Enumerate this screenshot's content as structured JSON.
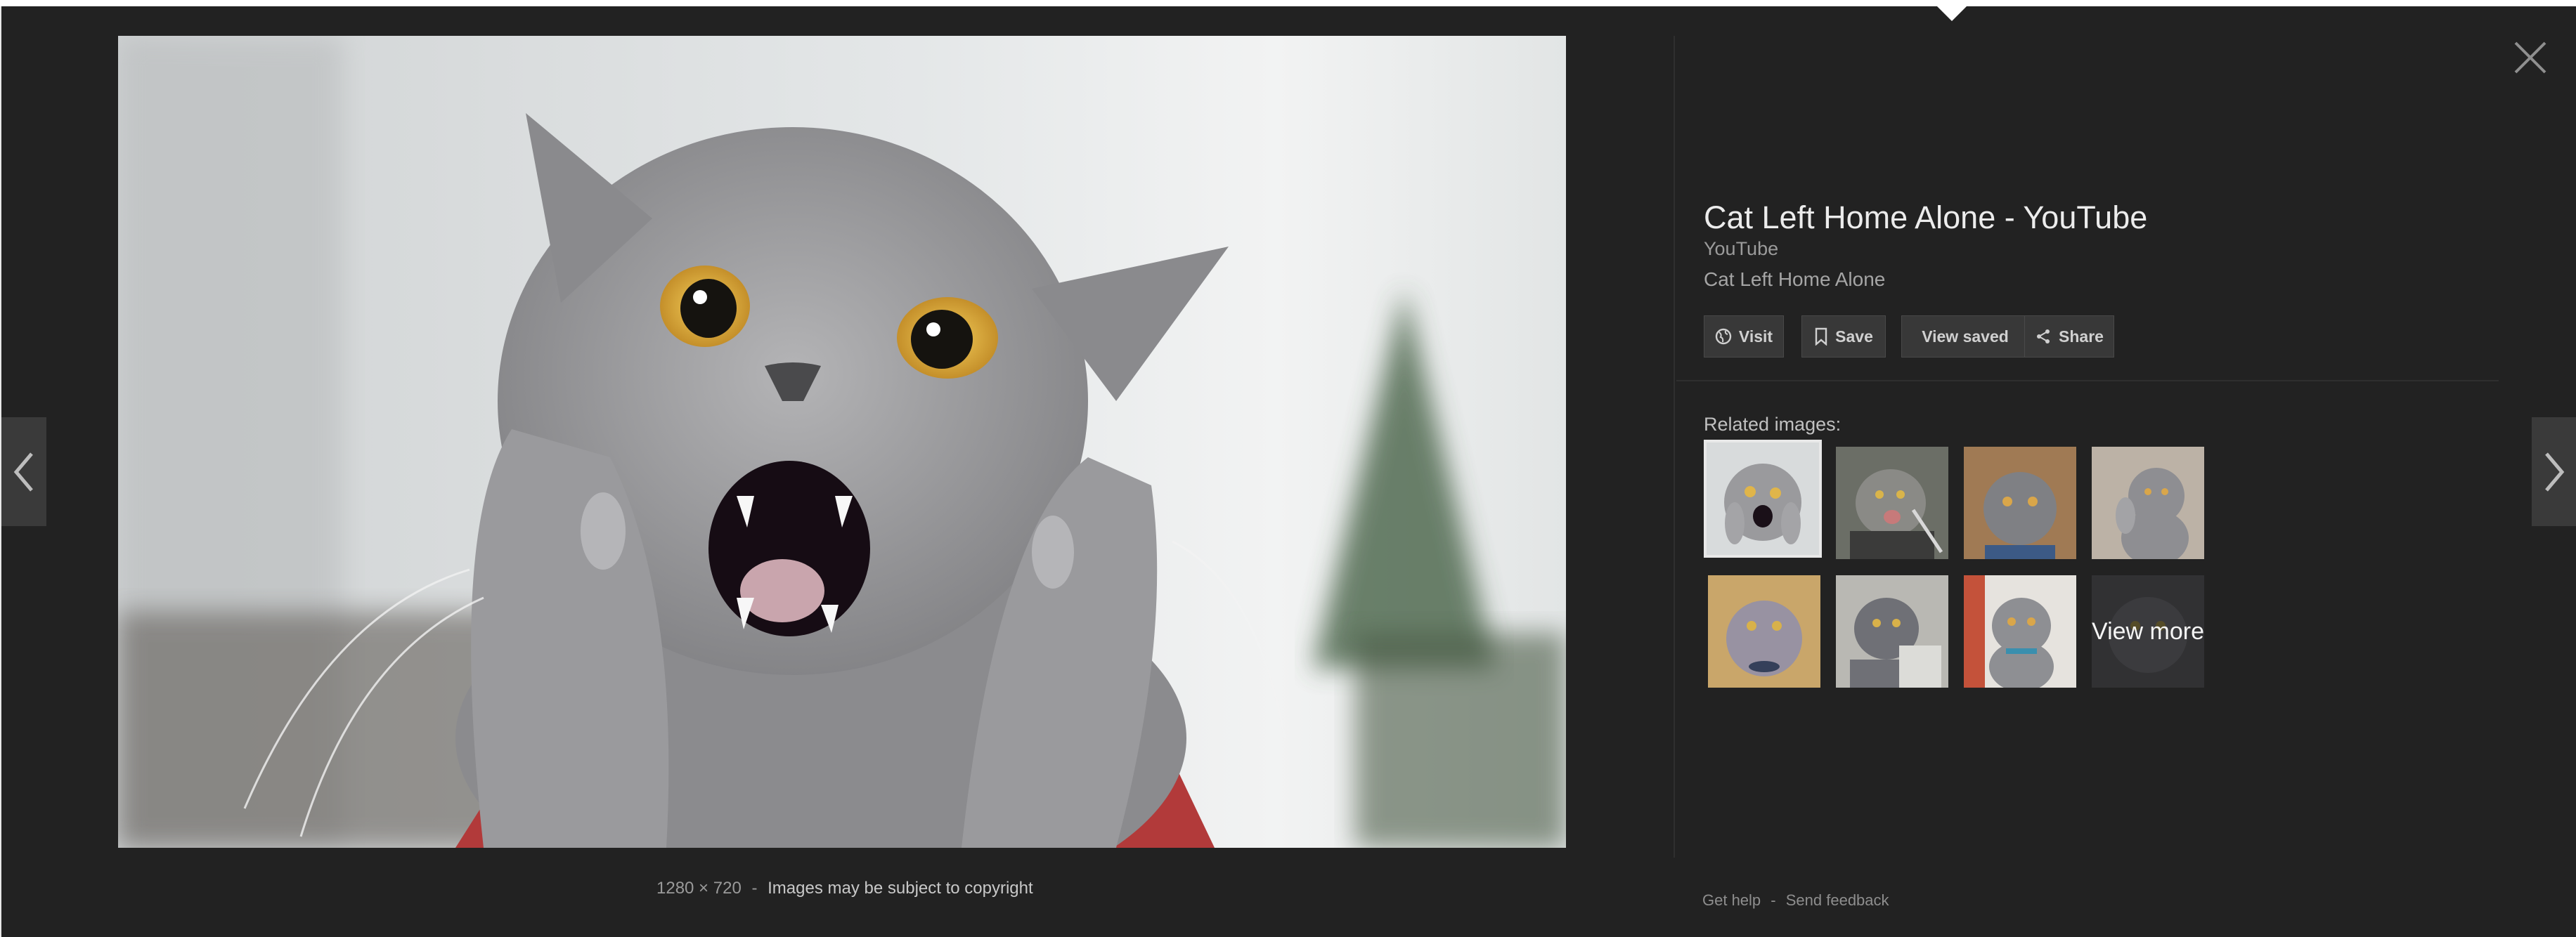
{
  "viewer": {
    "title": "Cat Left Home Alone - YouTube",
    "source": "YouTube",
    "description": "Cat Left Home Alone",
    "image_dimensions": "1280 × 720",
    "meta_separator": "-",
    "copyright_notice": "Images may be subject to copyright"
  },
  "actions": [
    {
      "label": "Visit",
      "icon": "globe-icon"
    },
    {
      "label": "Save",
      "icon": "bookmark-icon"
    },
    {
      "label": "View saved",
      "icon": ""
    },
    {
      "label": "Share",
      "icon": "share-icon"
    }
  ],
  "related": {
    "label": "Related images:",
    "view_more": "View more",
    "thumbnails": [
      {
        "subject": "surprised grey cat with paws up",
        "selected": true
      },
      {
        "subject": "grey cat with fork"
      },
      {
        "subject": "grey cat on wooden background"
      },
      {
        "subject": "grey cat waving paw"
      },
      {
        "subject": "grey cat with collar looking up"
      },
      {
        "subject": "grey cat at table"
      },
      {
        "subject": "grey cat with blue collar"
      },
      {
        "subject": "grey cat (view more)"
      }
    ]
  },
  "footer": {
    "help": "Get help",
    "separator": "-",
    "feedback": "Send feedback"
  },
  "colors": {
    "background": "#222222",
    "button_bg": "#383838",
    "text_primary": "#ececec",
    "text_secondary": "#9b9b9b"
  },
  "icons": {
    "close": "close-icon",
    "prev": "chevron-left-icon",
    "next": "chevron-right-icon"
  }
}
